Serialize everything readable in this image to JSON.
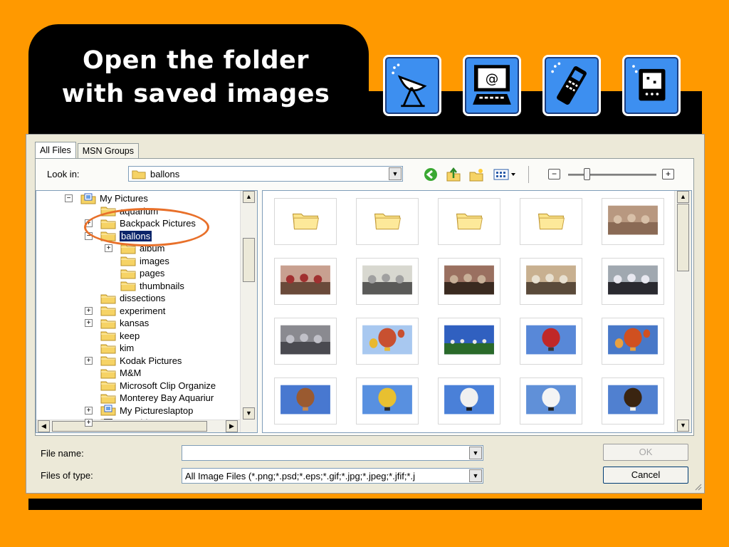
{
  "slide": {
    "title_line1": "Open the folder",
    "title_line2": "with saved images",
    "header_icons": [
      "satellite-dish-icon",
      "email-computer-icon",
      "mobile-phone-icon",
      "handheld-device-icon"
    ]
  },
  "dialog": {
    "tabs": [
      {
        "label": "All Files",
        "active": true
      },
      {
        "label": "MSN Groups",
        "active": false
      }
    ],
    "look_in_label": "Look in:",
    "look_in_value": "ballons",
    "tree": [
      {
        "label": "My Pictures",
        "expander": "−",
        "icon": "special",
        "level": 0
      },
      {
        "label": "aquarium",
        "expander": "",
        "icon": "folder",
        "level": 1
      },
      {
        "label": "Backpack Pictures",
        "expander": "+",
        "icon": "folder",
        "level": 1
      },
      {
        "label": "ballons",
        "expander": "−",
        "icon": "folder-open",
        "level": 1,
        "selected": true
      },
      {
        "label": "album",
        "expander": "+",
        "icon": "folder",
        "level": 2
      },
      {
        "label": "images",
        "expander": "",
        "icon": "folder",
        "level": 2
      },
      {
        "label": "pages",
        "expander": "",
        "icon": "folder",
        "level": 2
      },
      {
        "label": "thumbnails",
        "expander": "",
        "icon": "folder",
        "level": 2
      },
      {
        "label": "dissections",
        "expander": "",
        "icon": "folder",
        "level": 1
      },
      {
        "label": "experiment",
        "expander": "+",
        "icon": "folder",
        "level": 1
      },
      {
        "label": "kansas",
        "expander": "+",
        "icon": "folder",
        "level": 1
      },
      {
        "label": "keep",
        "expander": "",
        "icon": "folder",
        "level": 1
      },
      {
        "label": "kim",
        "expander": "",
        "icon": "folder",
        "level": 1
      },
      {
        "label": "Kodak Pictures",
        "expander": "+",
        "icon": "folder",
        "level": 1
      },
      {
        "label": "M&M",
        "expander": "",
        "icon": "folder",
        "level": 1
      },
      {
        "label": "Microsoft Clip Organize",
        "expander": "",
        "icon": "folder",
        "level": 1
      },
      {
        "label": "Monterey Bay Aquariur",
        "expander": "",
        "icon": "folder",
        "level": 1
      },
      {
        "label": "My Pictureslaptop",
        "expander": "+",
        "icon": "special",
        "level": 1
      },
      {
        "label": "My Videos",
        "expander": "+",
        "icon": "video",
        "level": 1
      }
    ],
    "thumbnails": [
      "folder",
      "folder",
      "folder",
      "folder",
      "photo-group",
      "photo-party",
      "photo-room",
      "photo-crowd",
      "photo-room2",
      "photo-lecture",
      "photo-table",
      "photo-balloons-sky",
      "photo-field-crowd",
      "photo-balloon-red",
      "photo-balloons-many",
      "photo-balloon-brown",
      "photo-balloon-yellow",
      "photo-balloon-cow",
      "photo-balloon-cow2",
      "photo-balloon-eagle"
    ],
    "file_name_label": "File name:",
    "file_name_value": "",
    "file_type_label": "Files of type:",
    "file_type_value": "All Image Files (*.png;*.psd;*.eps;*.gif;*.jpg;*.jpeg;*.jfif;*.j",
    "ok_label": "OK",
    "cancel_label": "Cancel",
    "slider_minus": "−",
    "slider_plus": "+",
    "selection_color": "#0a246a",
    "annotation_color": "#e8702a"
  }
}
